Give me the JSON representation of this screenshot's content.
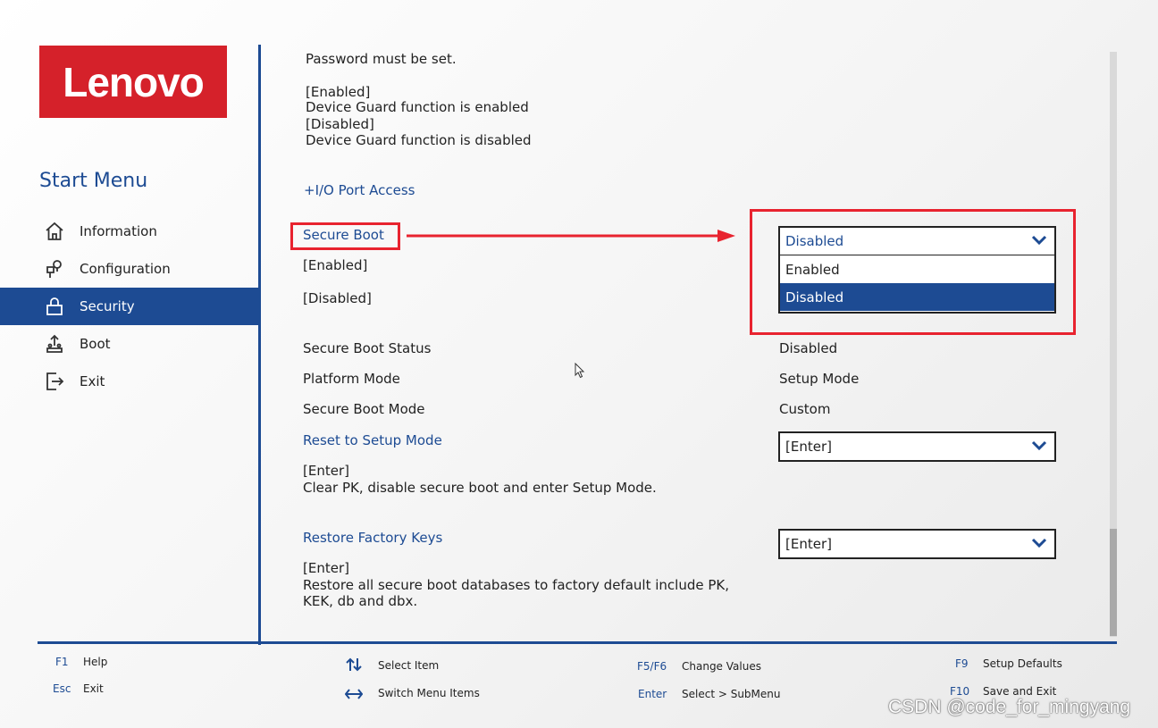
{
  "brand": {
    "logo_text": "Lenovo"
  },
  "sidebar": {
    "title": "Start Menu",
    "items": [
      {
        "label": "Information",
        "icon": "home-icon"
      },
      {
        "label": "Configuration",
        "icon": "configuration-icon"
      },
      {
        "label": "Security",
        "icon": "lock-icon",
        "active": true
      },
      {
        "label": "Boot",
        "icon": "boot-icon"
      },
      {
        "label": "Exit",
        "icon": "exit-icon"
      }
    ]
  },
  "content": {
    "device_guard": {
      "partial_line": "Password must be set.",
      "enabled_tag": "[Enabled]",
      "enabled_desc": "Device Guard function is enabled",
      "disabled_tag": "[Disabled]",
      "disabled_desc": "Device Guard function is disabled"
    },
    "io_port_access": "+I/O Port Access",
    "secure_boot": {
      "label": "Secure Boot",
      "enabled_tag": "[Enabled]",
      "disabled_tag": "[Disabled]",
      "dropdown_value": "Disabled",
      "options": [
        "Enabled",
        "Disabled"
      ],
      "selected_option": "Disabled"
    },
    "status_rows": [
      {
        "label": "Secure Boot Status",
        "value": "Disabled"
      },
      {
        "label": "Platform Mode",
        "value": "Setup Mode"
      },
      {
        "label": "Secure Boot Mode",
        "value": "Custom"
      }
    ],
    "reset_setup_mode": {
      "label": "Reset to Setup Mode",
      "value": "[Enter]",
      "tag": "[Enter]",
      "desc": "Clear PK, disable secure boot and enter Setup Mode."
    },
    "restore_factory_keys": {
      "label": "Restore Factory Keys",
      "value": "[Enter]",
      "tag": "[Enter]",
      "desc_line1": "Restore all secure boot databases to factory default include PK,",
      "desc_line2": "KEK, db and dbx."
    }
  },
  "footer": {
    "f1_key": "F1",
    "f1_label": "Help",
    "esc_key": "Esc",
    "esc_label": "Exit",
    "select_item_label": "Select Item",
    "switch_menu_label": "Switch Menu Items",
    "f5f6_key": "F5/F6",
    "f5f6_label": "Change Values",
    "enter_key": "Enter",
    "enter_label": "Select > SubMenu",
    "f9_key": "F9",
    "f9_label": "Setup Defaults",
    "f10_key": "F10",
    "f10_label": "Save and Exit"
  },
  "watermark": "CSDN @code_for_mingyang",
  "colors": {
    "accent": "#1d4b93",
    "brand": "#d5212a",
    "annotation": "#e8232f"
  }
}
